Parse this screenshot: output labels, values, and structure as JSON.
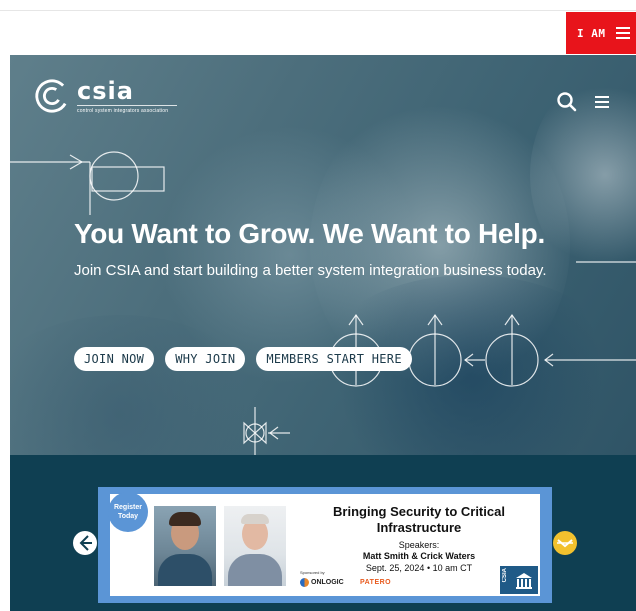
{
  "top_bar": {
    "iam_label": "I AM",
    "menu_icon": "hamburger-icon",
    "accent_color": "#e8141b"
  },
  "header": {
    "logo_name": "csia",
    "logo_tagline": "control system integrators association",
    "search_icon": "search-icon",
    "menu_icon": "hamburger-icon"
  },
  "hero": {
    "headline": "You Want to Grow. We Want to Help.",
    "subline": "Join CSIA and start building a better system integration business today.",
    "ctas": [
      "JOIN NOW",
      "WHY JOIN",
      "MEMBERS START HERE"
    ]
  },
  "event_banner": {
    "badge": [
      "Register",
      "Today"
    ],
    "title": "Bringing Security to Critical Infrastructure",
    "speakers_label": "Speakers:",
    "speakers": "Matt Smith & Crick Waters",
    "date": "Sept. 25, 2024 • 10 am CT",
    "sponsored_label": "Sponsored by",
    "sponsors": [
      "ONLOGIC",
      "PATERO"
    ],
    "badge_logo": "CSIA",
    "prev_icon": "arrow-left-icon",
    "next_icon": "arrow-right-icon"
  },
  "colors": {
    "band": "#0f3f52",
    "banner_frame": "#5b95d6",
    "next_arrow": "#f2c12e"
  }
}
